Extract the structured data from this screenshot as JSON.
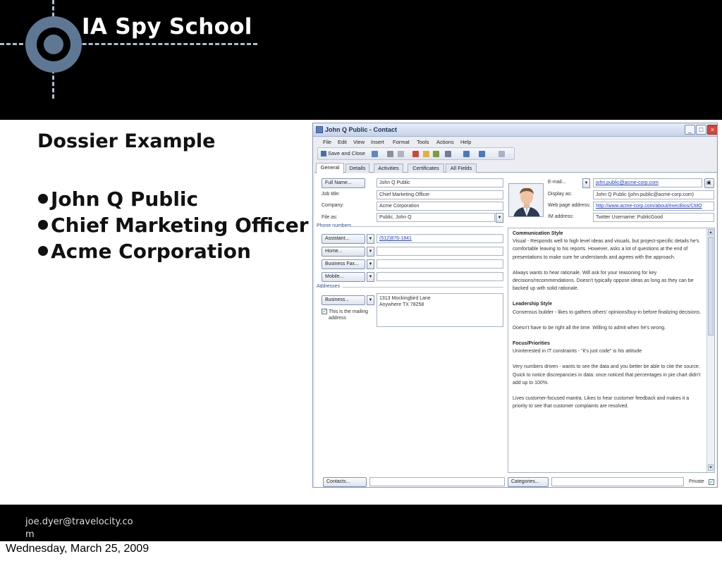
{
  "slide": {
    "header_title": "IA Spy School",
    "heading": "Dossier Example",
    "bullets": [
      "John Q Public",
      "Chief Marketing Officer",
      "Acme Corporation"
    ],
    "footer_email": "joe.dyer@travelocity.com",
    "date": "Wednesday, March 25, 2009"
  },
  "window": {
    "title": "John Q Public - Contact",
    "controls": {
      "minimize": "_",
      "maximize": "□",
      "close": "×"
    },
    "menu": [
      "File",
      "Edit",
      "View",
      "Insert",
      "Format",
      "Tools",
      "Actions",
      "Help"
    ],
    "toolbar": {
      "save_close": "Save and Close"
    },
    "tabs": [
      "General",
      "Details",
      "Activities",
      "Certificates",
      "All Fields"
    ],
    "active_tab": "General",
    "general": {
      "full_name_button": "Full Name...",
      "full_name_value": "John Q Public",
      "job_title_label": "Job title:",
      "job_title_value": "Chief Marketing Officer",
      "company_label": "Company:",
      "company_value": "Acme Corporation",
      "file_as_label": "File as:",
      "file_as_value": "Public, John Q",
      "phone_section": "Phone numbers",
      "phones": [
        {
          "button": "Assistant...",
          "value": "(512)876-1841"
        },
        {
          "button": "Home...",
          "value": ""
        },
        {
          "button": "Business Fax...",
          "value": ""
        },
        {
          "button": "Mobile...",
          "value": ""
        }
      ],
      "addresses_section": "Addresses",
      "address_button": "Business...",
      "address_line1": "1313 Mockingbird Lane",
      "address_line2": "Anywhere TX 78258",
      "mailing_checkbox_line1": "This is the mailing",
      "mailing_checkbox_line2": "address",
      "email_button": "E-mail...",
      "email_value": "john.public@acme-corp.com",
      "display_as_label": "Display as:",
      "display_as_value": "John Q Public (john.public@acme-corp.com)",
      "web_label": "Web page address:",
      "web_value": "http://www.acme-corp.com/about/execBios/CMO",
      "im_label": "IM address:",
      "im_value": "Twitter Username: PublicGood",
      "contacts_button": "Contacts...",
      "categories_button": "Categories...",
      "private_label": "Private"
    },
    "notes": [
      {
        "heading": "Communication Style",
        "text": "Visual - Responds well to high level ideas and visuals, but project-specific details he's comfortable leaving to his reports. However, asks a lot of questions at the end of presentations to make sure he understands and agrees with the approach."
      },
      {
        "heading": "",
        "text": "Always wants to hear rationale. Will ask for your reasoning for key decisions/recommendations. Doesn't typically oppose ideas as long as they can be backed up with solid rationale."
      },
      {
        "heading": "Leadership Style",
        "text": "Consensus builder - likes to gathers others' opinions/buy-in before finalizing decisions."
      },
      {
        "heading": "",
        "text": "Doesn't have to be right all the time. Willing to admit when he's wrong."
      },
      {
        "heading": "Focus/Priorities",
        "text": "Uninterested in IT constraints - \"it's just code\" is his attitude"
      },
      {
        "heading": "",
        "text": "Very numbers driven - wants to see the data and you better be able to cite the source. Quick to notice discrepancies in data: once noticed that percentages in pie chart didn't add up to 100%."
      },
      {
        "heading": "",
        "text": "Lives customer-focused mantra. Likes to hear customer feedback and makes it a priority to see that customer complaints are resolved."
      }
    ]
  },
  "colors": {
    "accent_blue": "#5e7894",
    "reticle": "#a8bed2",
    "link": "#2340c8"
  }
}
